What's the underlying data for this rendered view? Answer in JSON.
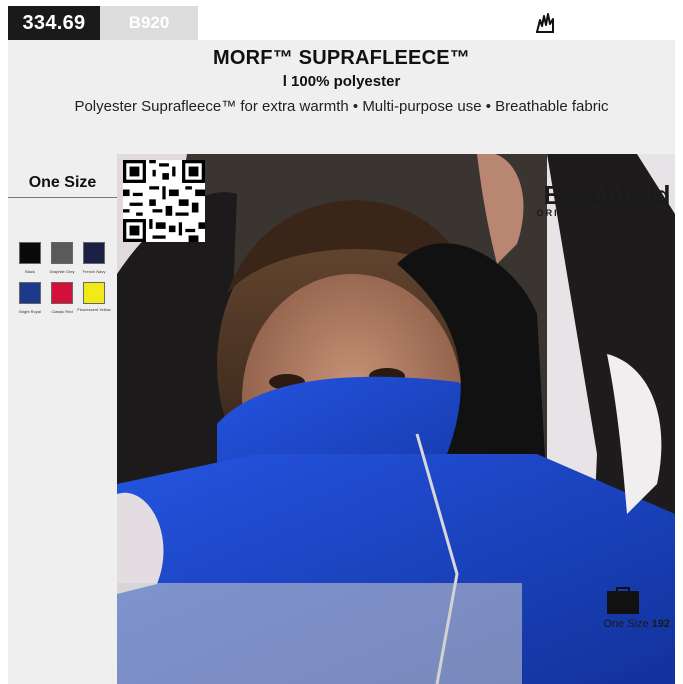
{
  "topbar": {
    "code": "334.69",
    "sku": "B920"
  },
  "header": {
    "title": "MORF™ SUPRAFLEECE™",
    "subtitle": "l 100% polyester",
    "features": "Polyester Suprafleece™ for extra warmth • Multi-purpose use • Breathable fabric"
  },
  "sizes": {
    "label": "One Size"
  },
  "colors": [
    {
      "name": "Black",
      "hex": "#0a0a0a"
    },
    {
      "name": "Graphite Grey",
      "hex": "#5a5a5a"
    },
    {
      "name": "French Navy",
      "hex": "#1b2145"
    },
    {
      "name": "Bright Royal",
      "hex": "#1d3a8a"
    },
    {
      "name": "Classic Red",
      "hex": "#d4103a"
    },
    {
      "name": "Fluorescent Yellow",
      "hex": "#f2ea18"
    }
  ],
  "brand": {
    "name": "Beechfield",
    "tagline": "ORIGINAL HEADWEAR"
  },
  "footer": {
    "size_label": "One Size",
    "size_count": "192"
  },
  "icons": {
    "top_right": "fire-icon",
    "bottom_right": "bag-icon"
  },
  "accent_colors": {
    "code_bg": "#1a1a1a",
    "sku_bg": "#dcdcdc",
    "panel_bg": "#efefef"
  }
}
